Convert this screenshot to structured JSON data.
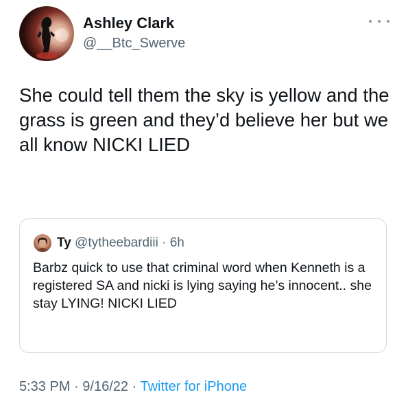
{
  "tweet": {
    "author": {
      "name": "Ashley Clark",
      "handle": "@__Btc_Swerve"
    },
    "more_icon": "more-horizontal-icon",
    "text": "She could tell them the sky is yellow and the grass is green and they’d believe her but we all know NICKI LIED",
    "quoted": {
      "name": "Ty",
      "handle": "@tytheebardiii",
      "separator": "·",
      "time": "6h",
      "text": "Barbz quick to use that criminal word when Kenneth is a registered SA and nicki is lying saying he’s innocent.. she stay LYING! NICKI LIED"
    },
    "footer": {
      "time": "5:33 PM",
      "separator1": "·",
      "date": "9/16/22",
      "separator2": "·",
      "source": "Twitter for iPhone"
    }
  },
  "colors": {
    "text": "#0f1419",
    "secondary": "#536471",
    "link": "#1d9bf0",
    "border": "#cfd9de"
  }
}
